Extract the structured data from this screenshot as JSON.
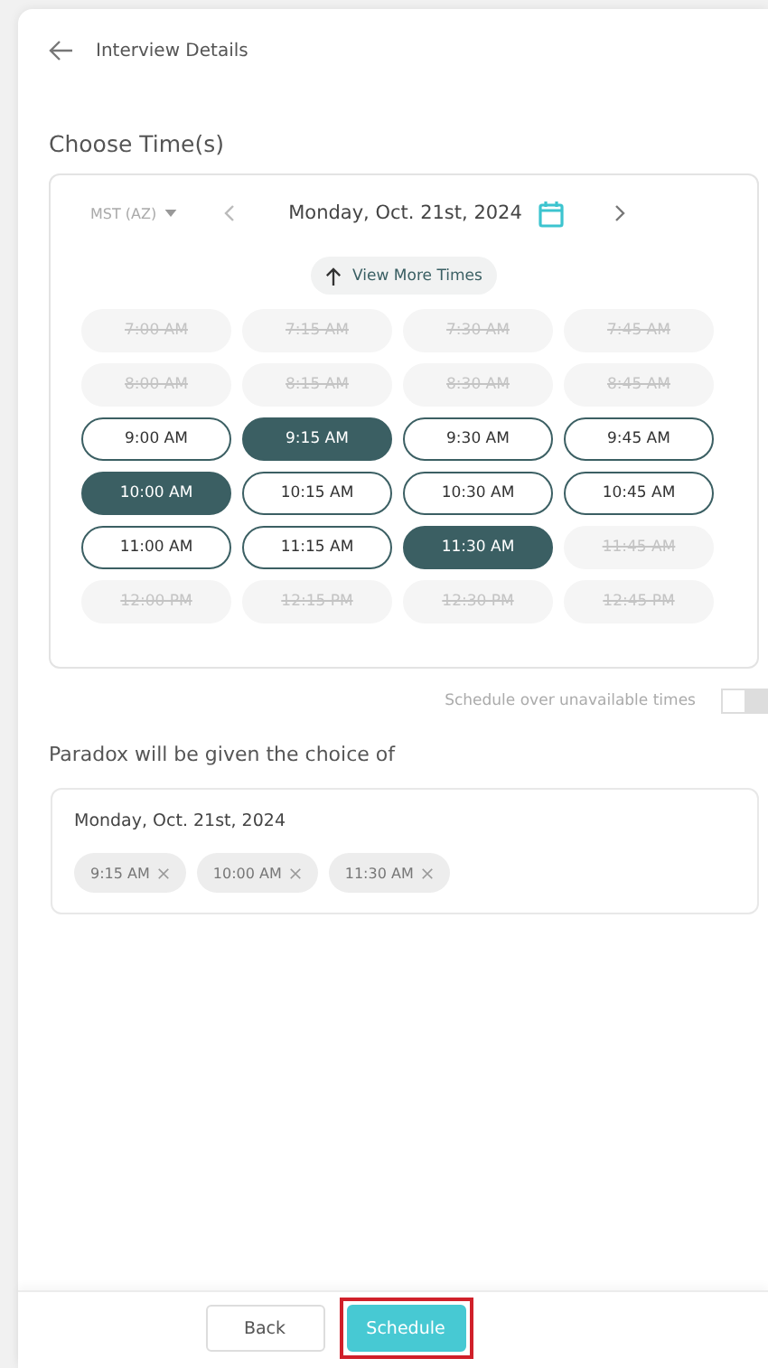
{
  "header": {
    "title": "Interview Details"
  },
  "section_title": "Choose Time(s)",
  "picker": {
    "timezone": "MST (AZ)",
    "date": "Monday, Oct. 21st, 2024",
    "view_more": "View More Times",
    "slots": [
      {
        "label": "7:00 AM",
        "available": false,
        "selected": false
      },
      {
        "label": "7:15 AM",
        "available": false,
        "selected": false
      },
      {
        "label": "7:30 AM",
        "available": false,
        "selected": false
      },
      {
        "label": "7:45 AM",
        "available": false,
        "selected": false
      },
      {
        "label": "8:00 AM",
        "available": false,
        "selected": false
      },
      {
        "label": "8:15 AM",
        "available": false,
        "selected": false
      },
      {
        "label": "8:30 AM",
        "available": false,
        "selected": false
      },
      {
        "label": "8:45 AM",
        "available": false,
        "selected": false
      },
      {
        "label": "9:00 AM",
        "available": true,
        "selected": false
      },
      {
        "label": "9:15 AM",
        "available": true,
        "selected": true
      },
      {
        "label": "9:30 AM",
        "available": true,
        "selected": false
      },
      {
        "label": "9:45 AM",
        "available": true,
        "selected": false
      },
      {
        "label": "10:00 AM",
        "available": true,
        "selected": true
      },
      {
        "label": "10:15 AM",
        "available": true,
        "selected": false
      },
      {
        "label": "10:30 AM",
        "available": true,
        "selected": false
      },
      {
        "label": "10:45 AM",
        "available": true,
        "selected": false
      },
      {
        "label": "11:00 AM",
        "available": true,
        "selected": false
      },
      {
        "label": "11:15 AM",
        "available": true,
        "selected": false
      },
      {
        "label": "11:30 AM",
        "available": true,
        "selected": true
      },
      {
        "label": "11:45 AM",
        "available": false,
        "selected": false
      },
      {
        "label": "12:00 PM",
        "available": false,
        "selected": false
      },
      {
        "label": "12:15 PM",
        "available": false,
        "selected": false
      },
      {
        "label": "12:30 PM",
        "available": false,
        "selected": false
      },
      {
        "label": "12:45 PM",
        "available": false,
        "selected": false
      }
    ]
  },
  "override": {
    "label": "Schedule over unavailable times",
    "on": false
  },
  "choice_title": "Paradox will be given the choice of",
  "choices": {
    "date": "Monday, Oct. 21st, 2024",
    "chips": [
      "9:15 AM",
      "10:00 AM",
      "11:30 AM"
    ]
  },
  "buttons": [
    {
      "label": "Back",
      "kind": "secondary",
      "highlighted": false
    },
    {
      "label": "Schedule",
      "kind": "primary",
      "highlighted": true
    }
  ]
}
